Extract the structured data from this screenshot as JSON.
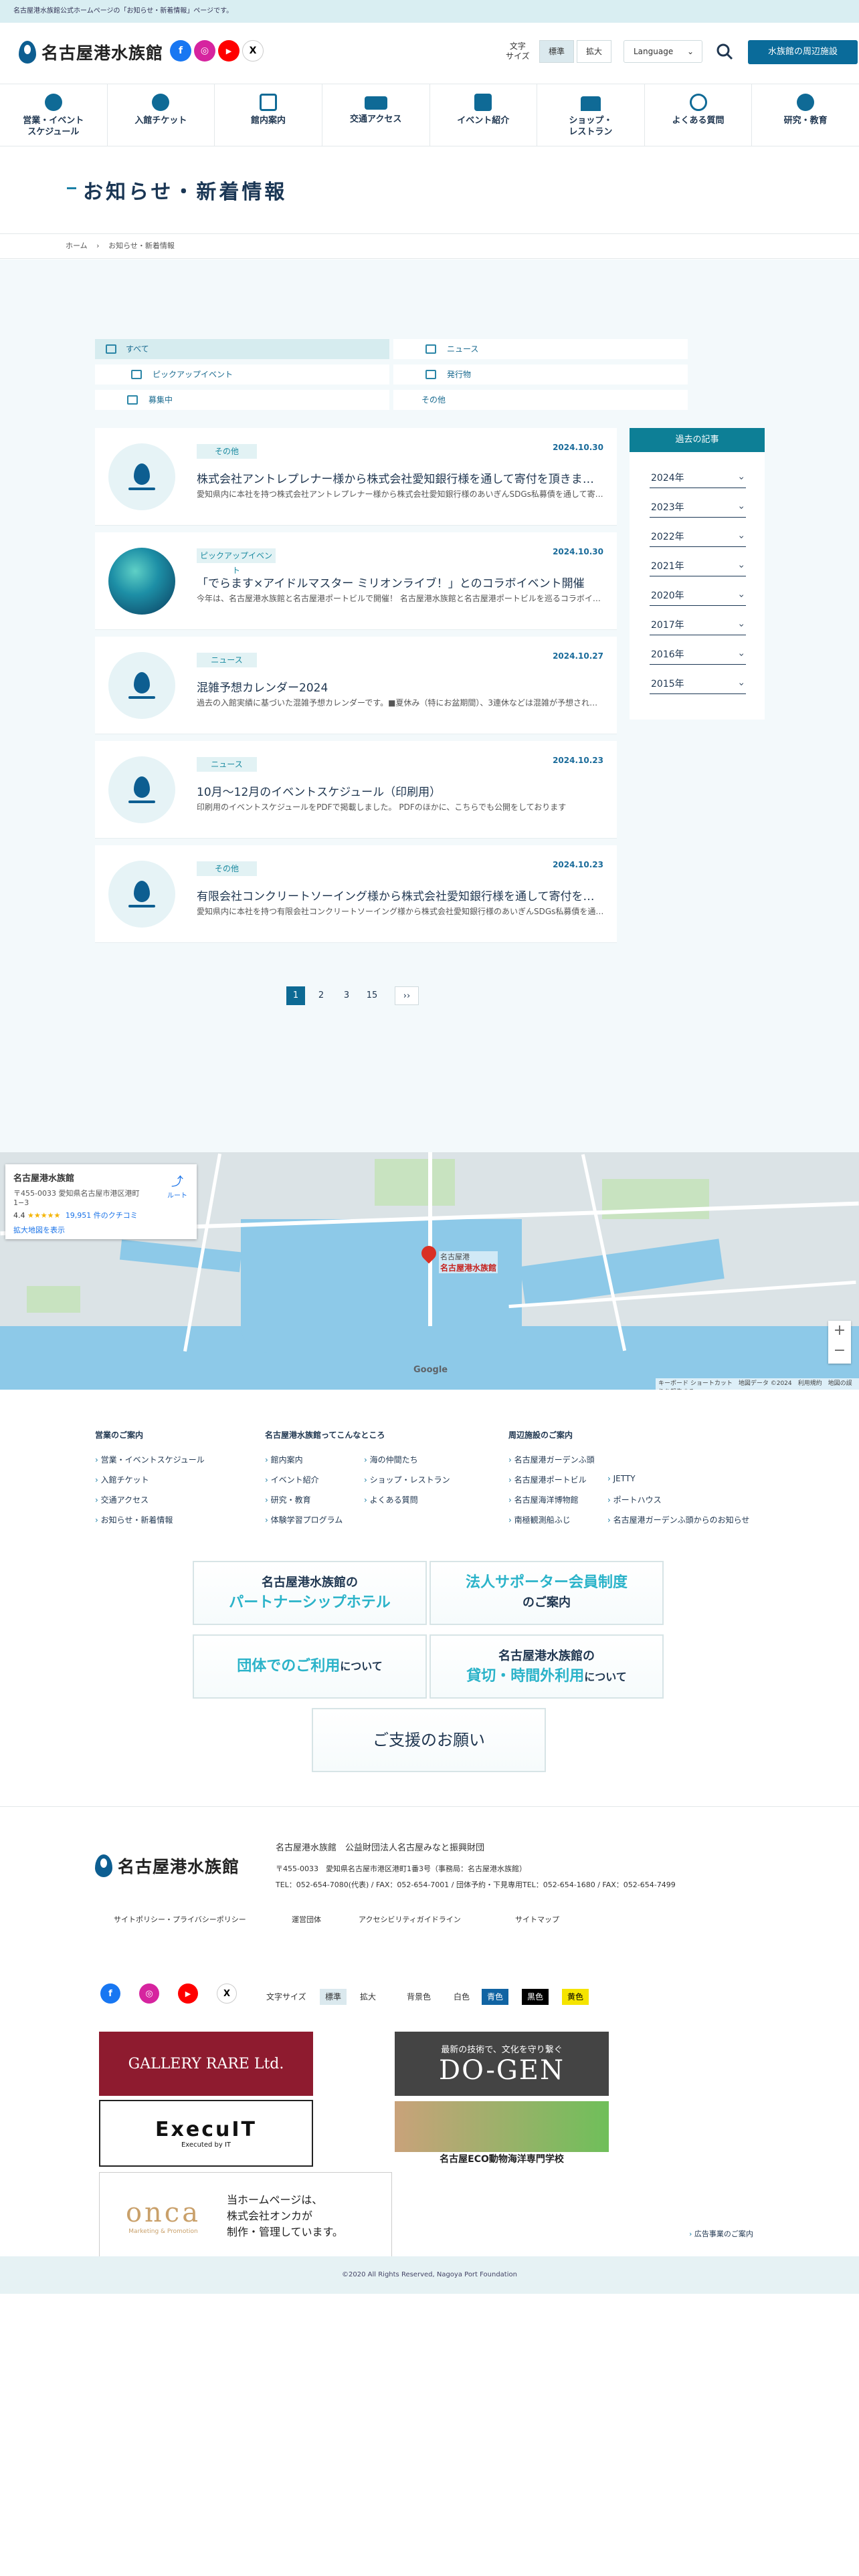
{
  "topbar": {
    "text": "名古屋港水族館公式ホームページの「お知らせ・新着情報」ページです。"
  },
  "header": {
    "logo_text": "名古屋港水族館",
    "social": [
      "f",
      "◎",
      "▶",
      "X"
    ],
    "font_size_label_1": "文字",
    "font_size_label_2": "サイズ",
    "font_standard": "標準",
    "font_large": "拡大",
    "language": "Language",
    "nearby_button": "水族館の周辺施設"
  },
  "nav": [
    {
      "label_1": "営業・イベント",
      "label_2": "スケジュール"
    },
    {
      "label_1": "入館チケット",
      "label_2": ""
    },
    {
      "label_1": "館内案内",
      "label_2": ""
    },
    {
      "label_1": "交通アクセス",
      "label_2": ""
    },
    {
      "label_1": "イベント紹介",
      "label_2": ""
    },
    {
      "label_1": "ショップ・",
      "label_2": "レストラン"
    },
    {
      "label_1": "よくある質問",
      "label_2": ""
    },
    {
      "label_1": "研究・教育",
      "label_2": ""
    }
  ],
  "page_title": "お知らせ・新着情報",
  "breadcrumb": {
    "home": "ホーム",
    "sep": "›",
    "current": "お知らせ・新着情報"
  },
  "filters": [
    "すべて",
    "ニュース",
    "ピックアップイベント",
    "発行物",
    "募集中",
    "その他"
  ],
  "news": [
    {
      "category": "その他",
      "date": "2024.10.30",
      "title": "株式会社アントレプレナー様から株式会社愛知銀行様を通して寄付を頂きました",
      "desc": "愛知県内に本社を持つ株式会社アントレプレナー様から株式会社愛知銀行様のあいぎんSDGs私募債を通して寄付を頂きました"
    },
    {
      "category": "ピックアップイベント",
      "date": "2024.10.30",
      "title": "「でらます×アイドルマスター ミリオンライブ！」とのコラボイベント開催",
      "desc": "今年は、名古屋港水族館と名古屋港ポートビルで開催！ 名古屋港水族館と名古屋港ポートビルを巡るコラボイベント"
    },
    {
      "category": "ニュース",
      "date": "2024.10.27",
      "title": "混雑予想カレンダー2024",
      "desc": "過去の入館実績に基づいた混雑予想カレンダーです。■夏休み（特にお盆期間）、3連休などは混雑が予想されます"
    },
    {
      "category": "ニュース",
      "date": "2024.10.23",
      "title": "10月～12月のイベントスケジュール（印刷用）",
      "desc": "印刷用のイベントスケジュールをPDFで掲載しました。 PDFのほかに、こちらでも公開をしております"
    },
    {
      "category": "その他",
      "date": "2024.10.23",
      "title": "有限会社コンクリートソーイング様から株式会社愛知銀行様を通して寄付を頂きました",
      "desc": "愛知県内に本社を持つ有限会社コンクリートソーイング様から株式会社愛知銀行様のあいぎんSDGs私募債を通して寄付を頂きました"
    }
  ],
  "sidebar": {
    "heading": "過去の記事",
    "years": [
      "2024年",
      "2023年",
      "2022年",
      "2021年",
      "2020年",
      "2017年",
      "2016年",
      "2015年"
    ]
  },
  "pager": [
    "1",
    "2",
    "3",
    "15",
    "››"
  ],
  "map": {
    "card_title": "名古屋港水族館",
    "card_address_1": "〒455-0033 愛知県名古屋市港区港町",
    "card_address_2": "1−3",
    "route": "ルート",
    "rating": "4.4",
    "stars": "★★★★★",
    "reviews": "19,951 件のクチコミ",
    "enlarge": "拡大地図を表示",
    "pin_label_1": "名古屋港",
    "pin_label_2": "名古屋港水族館",
    "attribution": "キーボード ショートカット　地図データ ©2024　利用規約　地図の誤りを報告する",
    "google": "Google"
  },
  "footer_nav": {
    "col1_title": "営業のご案内",
    "col1": [
      "営業・イベントスケジュール",
      "入館チケット",
      "交通アクセス",
      "お知らせ・新着情報"
    ],
    "col2_title": "名古屋港水族館ってこんなところ",
    "col2a": [
      "館内案内",
      "イベント紹介",
      "研究・教育",
      "体験学習プログラム"
    ],
    "col2b": [
      "海の仲間たち",
      "ショップ・レストラン",
      "よくある質問"
    ],
    "col3_title": "周辺施設のご案内",
    "col3a": [
      "名古屋港ガーデンふ頭",
      "名古屋港ポートビル",
      "名古屋海洋博物館",
      "南極観測船ふじ"
    ],
    "col3b": [
      "JETTY",
      "ポートハウス",
      "名古屋港ガーデンふ頭からのお知らせ"
    ]
  },
  "banners": {
    "b1_line1": "名古屋港水族館の",
    "b1_line2": "パートナーシップホテル",
    "b2_line1": "法人サポーター会員制度",
    "b2_line2": "のご案内",
    "b3_line1": "団体でのご利用",
    "b3_line2": "について",
    "b4_line1": "名古屋港水族館の",
    "b4_line2": "貸切・時間外利用",
    "b4_line3": "について",
    "b5": "ご支援のお願い"
  },
  "footer": {
    "logo_text": "名古屋港水族館",
    "org": "名古屋港水族館　公益財団法人名古屋みなと振興財団",
    "address": "〒455-0033　愛知県名古屋市港区港町1番3号（事務局：名古屋港水族館）",
    "tel": "TEL：052-654-7080(代表) / FAX：052-654-7001 / 団体予約・下見専用TEL：052-654-1680 / FAX：052-654-7499",
    "links": [
      "サイトポリシー・プライバシーポリシー",
      "運営団体",
      "アクセシビリティガイドライン",
      "サイトマップ"
    ],
    "font_size": "文字サイズ",
    "font_standard": "標準",
    "font_large": "拡大",
    "bg_color": "背景色",
    "bg_white": "白色",
    "bg_blue": "青色",
    "bg_black": "黒色",
    "bg_yellow": "黄色",
    "ad_gallery": "GALLERY RARE Ltd.",
    "ad_exec": "ExecuIT",
    "ad_exec_sub": "Executed by IT",
    "ad_dogen": "DO-GEN",
    "ad_dogen_sub": "最新の技術で、文化を守り繋ぐ",
    "ad_eco": "名古屋ECO動物海洋専門学校",
    "ad_onca": "onca",
    "ad_onca_sub": "Marketing & Promotion",
    "onca_text_1": "当ホームページは、",
    "onca_text_2": "株式会社オンカが",
    "onca_text_3": "制作・管理しています。",
    "ad_info": "広告事業のご案内",
    "copyright": "©2020 All Rights Reserved, Nagoya Port Foundation"
  }
}
